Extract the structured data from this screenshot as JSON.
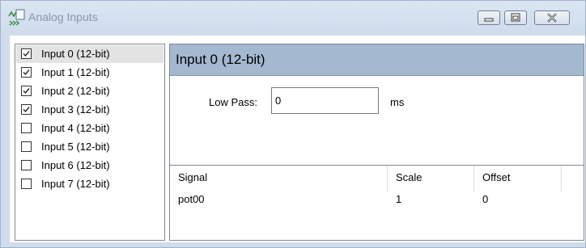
{
  "window": {
    "title": "Analog Inputs",
    "icon": "analog-waveform-icon",
    "controls": {
      "minimize_icon": "minimize-icon",
      "maximize_icon": "maximize-icon",
      "close_icon": "close-icon"
    }
  },
  "inputs": {
    "items": [
      {
        "label": "Input 0 (12-bit)",
        "checked": true,
        "selected": true
      },
      {
        "label": "Input 1 (12-bit)",
        "checked": true,
        "selected": false
      },
      {
        "label": "Input 2 (12-bit)",
        "checked": true,
        "selected": false
      },
      {
        "label": "Input 3 (12-bit)",
        "checked": true,
        "selected": false
      },
      {
        "label": "Input 4 (12-bit)",
        "checked": false,
        "selected": false
      },
      {
        "label": "Input 5 (12-bit)",
        "checked": false,
        "selected": false
      },
      {
        "label": "Input 6 (12-bit)",
        "checked": false,
        "selected": false
      },
      {
        "label": "Input 7 (12-bit)",
        "checked": false,
        "selected": false
      }
    ]
  },
  "detail": {
    "title": "Input 0 (12-bit)",
    "low_pass": {
      "label": "Low Pass:",
      "value": "0",
      "unit": "ms"
    },
    "table": {
      "columns": [
        "Signal",
        "Scale",
        "Offset"
      ],
      "rows": [
        {
          "signal": "pot00",
          "scale": "1",
          "offset": "0"
        }
      ]
    }
  },
  "colors": {
    "header_accent": "#a4b8d0",
    "window_frame": "#cfdcec",
    "selection": "#e3e3e3"
  }
}
